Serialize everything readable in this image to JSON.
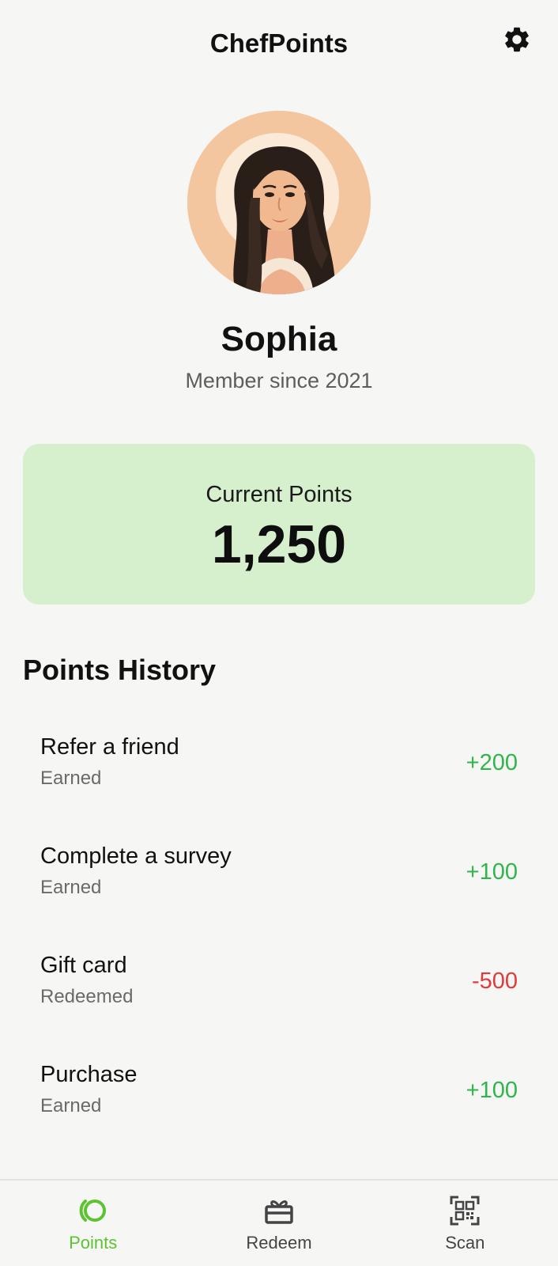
{
  "app": {
    "title": "ChefPoints"
  },
  "profile": {
    "name": "Sophia",
    "member_since": "Member since 2021"
  },
  "points_card": {
    "label": "Current Points",
    "value": "1,250"
  },
  "history": {
    "title": "Points History",
    "items": [
      {
        "title": "Refer a friend",
        "type": "Earned",
        "points": "+200",
        "kind": "earned"
      },
      {
        "title": "Complete a survey",
        "type": "Earned",
        "points": "+100",
        "kind": "earned"
      },
      {
        "title": "Gift card",
        "type": "Redeemed",
        "points": "-500",
        "kind": "redeemed"
      },
      {
        "title": "Purchase",
        "type": "Earned",
        "points": "+100",
        "kind": "earned"
      }
    ]
  },
  "nav": {
    "items": [
      {
        "label": "Points",
        "icon": "points-icon",
        "active": true
      },
      {
        "label": "Redeem",
        "icon": "gift-icon",
        "active": false
      },
      {
        "label": "Scan",
        "icon": "qr-scan-icon",
        "active": false
      }
    ]
  },
  "colors": {
    "background": "#f6f7f4",
    "card": "#d6efcd",
    "earned": "#2fb54a",
    "redeemed": "#e03a3a",
    "accent": "#5dc333"
  }
}
